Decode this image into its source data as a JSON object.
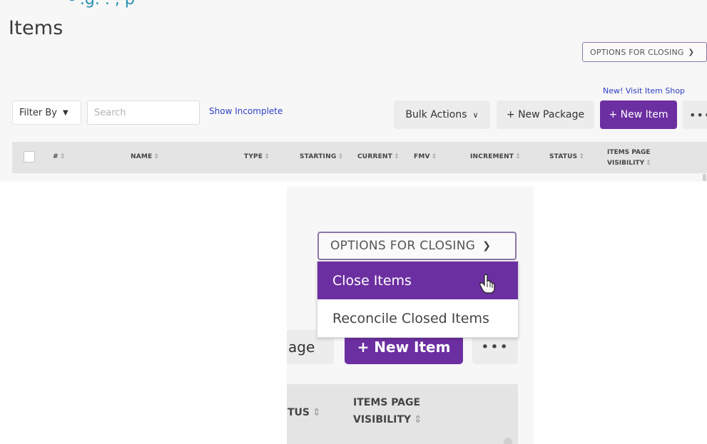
{
  "header": {
    "cut_text": "-   .g.   .   ,   p   ",
    "title": "Items"
  },
  "options": {
    "label": "OPTIONS FOR CLOSING",
    "chevron": "chevron-down-icon",
    "menu": [
      {
        "label": "Close Items",
        "active": true
      },
      {
        "label": "Reconcile Closed Items",
        "active": false
      }
    ]
  },
  "toolbar": {
    "shop_link": "New! Visit Item Shop",
    "filter_label": "Filter By",
    "search_placeholder": "Search",
    "show_incomplete": "Show Incomplete",
    "bulk_actions": "Bulk Actions",
    "new_package": "+ New Package",
    "new_package_cut": "age",
    "new_item": "+ New Item",
    "more": "•••"
  },
  "table": {
    "columns": [
      "#",
      "NAME",
      "TYPE",
      "STARTING",
      "CURRENT",
      "FMV",
      "INCREMENT",
      "STATUS"
    ],
    "visibility_line1": "ITEMS PAGE",
    "visibility_line2": "VISIBILITY",
    "status_cut": "TUS",
    "sort_glyph": "⇕"
  },
  "colors": {
    "accent": "#6c2fa1",
    "link": "#2f3fc5",
    "button_gray": "#ececec",
    "header_gray": "#e4e4e4"
  }
}
